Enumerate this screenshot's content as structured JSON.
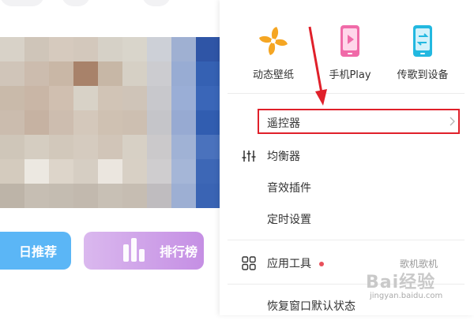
{
  "colors": {
    "accent_blue": "#5bb6f6",
    "accent_purple": "#c58fe4",
    "annotation_red": "#e0202a",
    "dot_red": "#e8505b"
  },
  "left": {
    "recommend_label": "日推荐",
    "rank_label": "排行榜"
  },
  "menu": {
    "tiles": [
      {
        "label": "动态壁纸",
        "icon": "pinwheel-icon"
      },
      {
        "label": "手机Play",
        "icon": "phone-play-icon"
      },
      {
        "label": "传歌到设备",
        "icon": "phone-transfer-icon"
      }
    ],
    "items": [
      {
        "label": "遥控器",
        "icon": null,
        "has_chevron": true,
        "highlighted": true
      },
      {
        "label": "均衡器",
        "icon": "equalizer-icon"
      },
      {
        "label": "音效插件",
        "icon": null
      },
      {
        "label": "定时设置",
        "icon": null
      },
      {
        "label": "应用工具",
        "icon": "grid-icon",
        "has_dot": true
      },
      {
        "label": "恢复窗口默认状态",
        "icon": null
      }
    ]
  },
  "watermark": {
    "line1": "歌机歌机",
    "line2": "Bai经验",
    "line3": "jingyan.baidu.com"
  }
}
